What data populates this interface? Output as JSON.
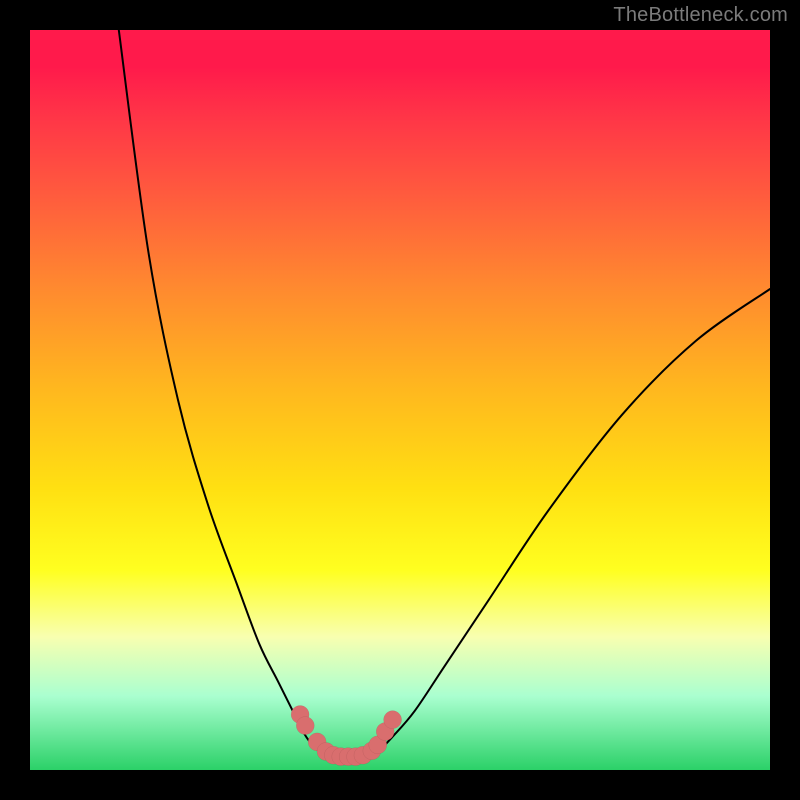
{
  "watermark": {
    "text": "TheBottleneck.com"
  },
  "colors": {
    "accent_dot": "#d96e6e",
    "curve": "#000000",
    "frame": "#000000"
  },
  "chart_data": {
    "type": "line",
    "title": "",
    "xlabel": "",
    "ylabel": "",
    "xlim": [
      0,
      100
    ],
    "ylim": [
      0,
      100
    ],
    "grid": false,
    "legend": false,
    "curve_left": {
      "name": "left-branch",
      "x": [
        12.0,
        16.0,
        20.0,
        24.0,
        28.0,
        31.0,
        33.5,
        35.5,
        37.0,
        38.5,
        40.0,
        41.0
      ],
      "y": [
        100.0,
        70.0,
        50.0,
        36.0,
        25.0,
        17.0,
        12.0,
        8.0,
        5.0,
        3.0,
        2.0,
        1.5
      ]
    },
    "curve_right": {
      "name": "right-branch",
      "x": [
        45.0,
        47.0,
        49.0,
        52.0,
        56.0,
        62.0,
        70.0,
        80.0,
        90.0,
        100.0
      ],
      "y": [
        1.5,
        2.5,
        4.5,
        8.0,
        14.0,
        23.0,
        35.0,
        48.0,
        58.0,
        65.0
      ]
    },
    "annotation_dots": {
      "x": [
        36.5,
        37.2,
        38.8,
        40.0,
        41.0,
        42.0,
        43.0,
        44.0,
        45.0,
        46.2,
        47.0,
        48.0,
        49.0
      ],
      "y": [
        7.5,
        6.0,
        3.8,
        2.5,
        2.0,
        1.8,
        1.8,
        1.8,
        2.0,
        2.6,
        3.4,
        5.2,
        6.8
      ]
    }
  }
}
